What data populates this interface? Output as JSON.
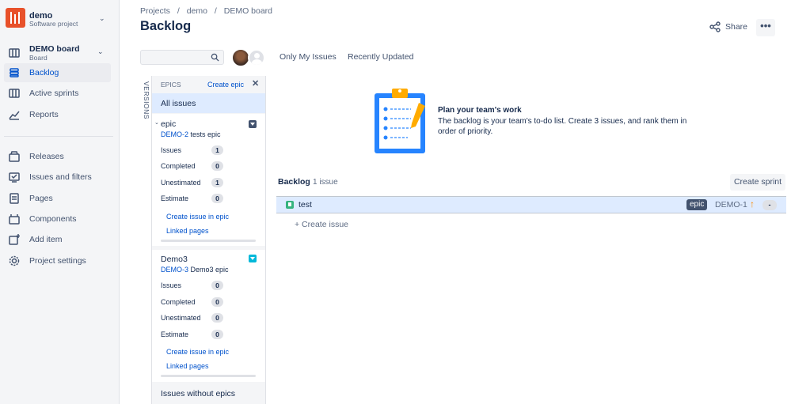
{
  "project": {
    "name": "demo",
    "type": "Software project",
    "color": "#e8512a"
  },
  "board": {
    "name": "DEMO board",
    "type": "Board"
  },
  "nav": {
    "backlog": "Backlog",
    "active_sprints": "Active sprints",
    "reports": "Reports",
    "releases": "Releases",
    "issues_filters": "Issues and filters",
    "pages": "Pages",
    "components": "Components",
    "add_item": "Add item",
    "settings": "Project settings"
  },
  "breadcrumb": [
    "Projects",
    "/",
    "demo",
    "/",
    "DEMO board"
  ],
  "page_title": "Backlog",
  "header": {
    "share_label": "Share",
    "more_label": "•••"
  },
  "filters": {
    "search_placeholder": "",
    "only_my_issues": "Only My Issues",
    "recently_updated": "Recently Updated"
  },
  "versions_tab": "VERSIONS",
  "epics_panel": {
    "title": "EPICS",
    "create_label": "Create epic",
    "close": "✕",
    "all_issues": "All issues",
    "no_epic": "Issues without epics",
    "epics": [
      {
        "name": "epic",
        "key": "DEMO-2",
        "summary": "tests epic",
        "color": "#42526e",
        "stats": [
          {
            "label": "Issues",
            "value": "1"
          },
          {
            "label": "Completed",
            "value": "0"
          },
          {
            "label": "Unestimated",
            "value": "1"
          },
          {
            "label": "Estimate",
            "value": "0"
          }
        ],
        "create_issue": "Create issue in epic",
        "linked_pages": "Linked pages"
      },
      {
        "name": "Demo3",
        "key": "DEMO-3",
        "summary": "Demo3 epic",
        "color": "#00b8d9",
        "stats": [
          {
            "label": "Issues",
            "value": "0"
          },
          {
            "label": "Completed",
            "value": "0"
          },
          {
            "label": "Unestimated",
            "value": "0"
          },
          {
            "label": "Estimate",
            "value": "0"
          }
        ],
        "create_issue": "Create issue in epic",
        "linked_pages": "Linked pages"
      }
    ]
  },
  "empty_state": {
    "title": "Plan your team's work",
    "description": "The backlog is your team's to-do list. Create 3 issues, and rank them in order of priority."
  },
  "backlog": {
    "title": "Backlog",
    "count": "1 issue",
    "create_sprint": "Create sprint",
    "issues": [
      {
        "summary": "test",
        "epic": "epic",
        "key": "DEMO-1",
        "priority": "↑",
        "estimate": "-"
      }
    ],
    "create_issue": "+  Create issue"
  },
  "colors": {
    "accent": "#0052cc",
    "selected": "#deebff",
    "story": "#36b37e",
    "priority": "#ff8b00"
  }
}
